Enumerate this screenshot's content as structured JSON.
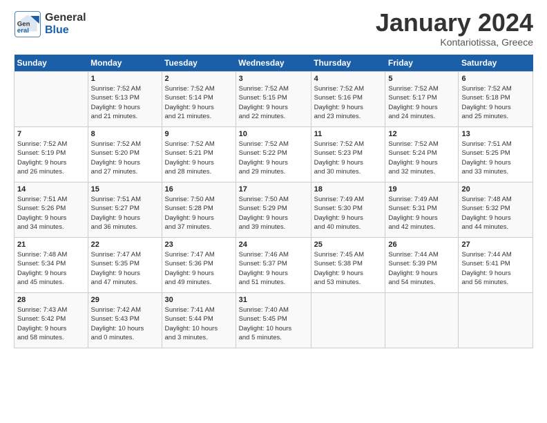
{
  "header": {
    "logo_general": "General",
    "logo_blue": "Blue",
    "month_title": "January 2024",
    "subtitle": "Kontariotissa, Greece"
  },
  "calendar": {
    "days_of_week": [
      "Sunday",
      "Monday",
      "Tuesday",
      "Wednesday",
      "Thursday",
      "Friday",
      "Saturday"
    ],
    "weeks": [
      [
        {
          "day": "",
          "info": ""
        },
        {
          "day": "1",
          "info": "Sunrise: 7:52 AM\nSunset: 5:13 PM\nDaylight: 9 hours\nand 21 minutes."
        },
        {
          "day": "2",
          "info": "Sunrise: 7:52 AM\nSunset: 5:14 PM\nDaylight: 9 hours\nand 21 minutes."
        },
        {
          "day": "3",
          "info": "Sunrise: 7:52 AM\nSunset: 5:15 PM\nDaylight: 9 hours\nand 22 minutes."
        },
        {
          "day": "4",
          "info": "Sunrise: 7:52 AM\nSunset: 5:16 PM\nDaylight: 9 hours\nand 23 minutes."
        },
        {
          "day": "5",
          "info": "Sunrise: 7:52 AM\nSunset: 5:17 PM\nDaylight: 9 hours\nand 24 minutes."
        },
        {
          "day": "6",
          "info": "Sunrise: 7:52 AM\nSunset: 5:18 PM\nDaylight: 9 hours\nand 25 minutes."
        }
      ],
      [
        {
          "day": "7",
          "info": "Sunrise: 7:52 AM\nSunset: 5:19 PM\nDaylight: 9 hours\nand 26 minutes."
        },
        {
          "day": "8",
          "info": "Sunrise: 7:52 AM\nSunset: 5:20 PM\nDaylight: 9 hours\nand 27 minutes."
        },
        {
          "day": "9",
          "info": "Sunrise: 7:52 AM\nSunset: 5:21 PM\nDaylight: 9 hours\nand 28 minutes."
        },
        {
          "day": "10",
          "info": "Sunrise: 7:52 AM\nSunset: 5:22 PM\nDaylight: 9 hours\nand 29 minutes."
        },
        {
          "day": "11",
          "info": "Sunrise: 7:52 AM\nSunset: 5:23 PM\nDaylight: 9 hours\nand 30 minutes."
        },
        {
          "day": "12",
          "info": "Sunrise: 7:52 AM\nSunset: 5:24 PM\nDaylight: 9 hours\nand 32 minutes."
        },
        {
          "day": "13",
          "info": "Sunrise: 7:51 AM\nSunset: 5:25 PM\nDaylight: 9 hours\nand 33 minutes."
        }
      ],
      [
        {
          "day": "14",
          "info": "Sunrise: 7:51 AM\nSunset: 5:26 PM\nDaylight: 9 hours\nand 34 minutes."
        },
        {
          "day": "15",
          "info": "Sunrise: 7:51 AM\nSunset: 5:27 PM\nDaylight: 9 hours\nand 36 minutes."
        },
        {
          "day": "16",
          "info": "Sunrise: 7:50 AM\nSunset: 5:28 PM\nDaylight: 9 hours\nand 37 minutes."
        },
        {
          "day": "17",
          "info": "Sunrise: 7:50 AM\nSunset: 5:29 PM\nDaylight: 9 hours\nand 39 minutes."
        },
        {
          "day": "18",
          "info": "Sunrise: 7:49 AM\nSunset: 5:30 PM\nDaylight: 9 hours\nand 40 minutes."
        },
        {
          "day": "19",
          "info": "Sunrise: 7:49 AM\nSunset: 5:31 PM\nDaylight: 9 hours\nand 42 minutes."
        },
        {
          "day": "20",
          "info": "Sunrise: 7:48 AM\nSunset: 5:32 PM\nDaylight: 9 hours\nand 44 minutes."
        }
      ],
      [
        {
          "day": "21",
          "info": "Sunrise: 7:48 AM\nSunset: 5:34 PM\nDaylight: 9 hours\nand 45 minutes."
        },
        {
          "day": "22",
          "info": "Sunrise: 7:47 AM\nSunset: 5:35 PM\nDaylight: 9 hours\nand 47 minutes."
        },
        {
          "day": "23",
          "info": "Sunrise: 7:47 AM\nSunset: 5:36 PM\nDaylight: 9 hours\nand 49 minutes."
        },
        {
          "day": "24",
          "info": "Sunrise: 7:46 AM\nSunset: 5:37 PM\nDaylight: 9 hours\nand 51 minutes."
        },
        {
          "day": "25",
          "info": "Sunrise: 7:45 AM\nSunset: 5:38 PM\nDaylight: 9 hours\nand 53 minutes."
        },
        {
          "day": "26",
          "info": "Sunrise: 7:44 AM\nSunset: 5:39 PM\nDaylight: 9 hours\nand 54 minutes."
        },
        {
          "day": "27",
          "info": "Sunrise: 7:44 AM\nSunset: 5:41 PM\nDaylight: 9 hours\nand 56 minutes."
        }
      ],
      [
        {
          "day": "28",
          "info": "Sunrise: 7:43 AM\nSunset: 5:42 PM\nDaylight: 9 hours\nand 58 minutes."
        },
        {
          "day": "29",
          "info": "Sunrise: 7:42 AM\nSunset: 5:43 PM\nDaylight: 10 hours\nand 0 minutes."
        },
        {
          "day": "30",
          "info": "Sunrise: 7:41 AM\nSunset: 5:44 PM\nDaylight: 10 hours\nand 3 minutes."
        },
        {
          "day": "31",
          "info": "Sunrise: 7:40 AM\nSunset: 5:45 PM\nDaylight: 10 hours\nand 5 minutes."
        },
        {
          "day": "",
          "info": ""
        },
        {
          "day": "",
          "info": ""
        },
        {
          "day": "",
          "info": ""
        }
      ]
    ]
  }
}
